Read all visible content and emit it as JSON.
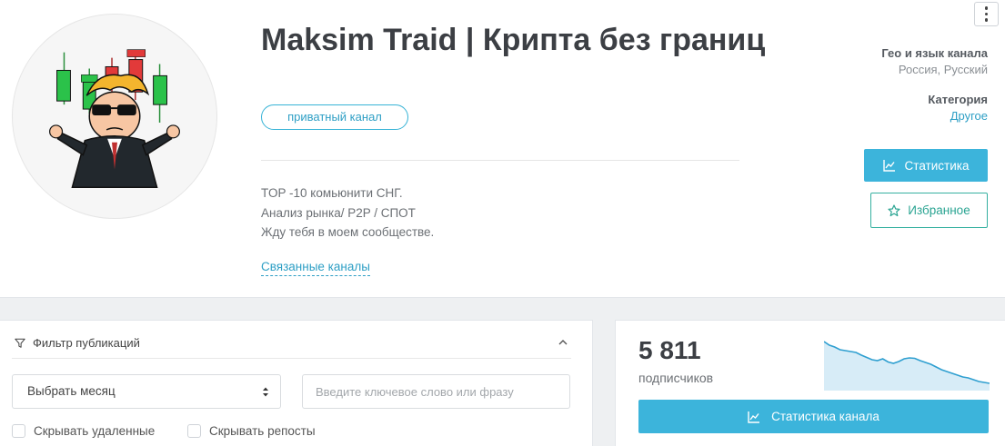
{
  "channel": {
    "title": "Maksim Traid | Крипта без границ",
    "badge": "приватный канал",
    "description": [
      "TOP -10 комьюнити СНГ.",
      "Анализ рынка/ P2P / СПОТ",
      "Жду тебя в моем сообществе."
    ],
    "related_link": "Связанные каналы",
    "avatar_icon": "trader-meme-avatar-icon"
  },
  "meta": {
    "geo_label": "Гео и язык канала",
    "geo_value": "Россия, Русский",
    "category_label": "Категория",
    "category_value": "Другое"
  },
  "actions": {
    "stats_button": "Статистика",
    "favorite_button": "Избранное",
    "more_icon": "vertical-dots-icon"
  },
  "filter": {
    "title": "Фильтр публикаций",
    "month_select": "Выбрать месяц",
    "search_placeholder": "Введите ключевое слово или фразу",
    "search_value": "",
    "hide_deleted": "Скрывать удаленные",
    "hide_reposts": "Скрывать репосты",
    "hide_deleted_checked": false,
    "hide_reposts_checked": false
  },
  "subscribers": {
    "count": "5 811",
    "label": "подписчиков",
    "channel_stats_button": "Статистика канала",
    "trend": [
      100,
      92,
      88,
      82,
      80,
      78,
      76,
      70,
      65,
      60,
      58,
      62,
      55,
      52,
      56,
      62,
      64,
      63,
      58,
      54,
      50,
      44,
      38,
      34,
      30,
      26,
      22,
      20,
      16,
      12,
      10,
      8
    ]
  },
  "colors": {
    "accent": "#3cb4db",
    "favorite": "#2aa492",
    "link": "#2e9fc5",
    "sparkline": "#2f9fd0",
    "sparkline_fill": "#d7ecf7",
    "candle_green": "#2bc24a",
    "candle_red": "#e23a3a"
  }
}
